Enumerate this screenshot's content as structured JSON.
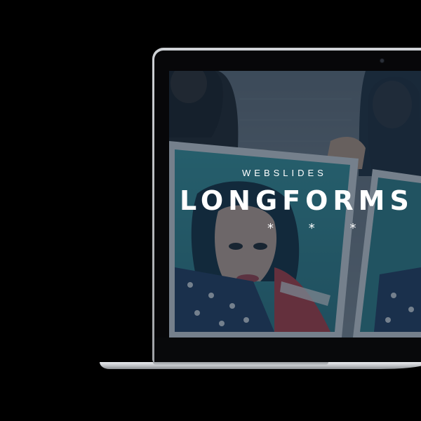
{
  "slide": {
    "kicker": "WEBSLIDES",
    "title": "LONGFORMS",
    "stars": "* * *"
  },
  "colors": {
    "background": "#000000",
    "text": "#ffffff",
    "overlay_tint": "#16283a",
    "laptop_silver": "#c8cbcf"
  }
}
